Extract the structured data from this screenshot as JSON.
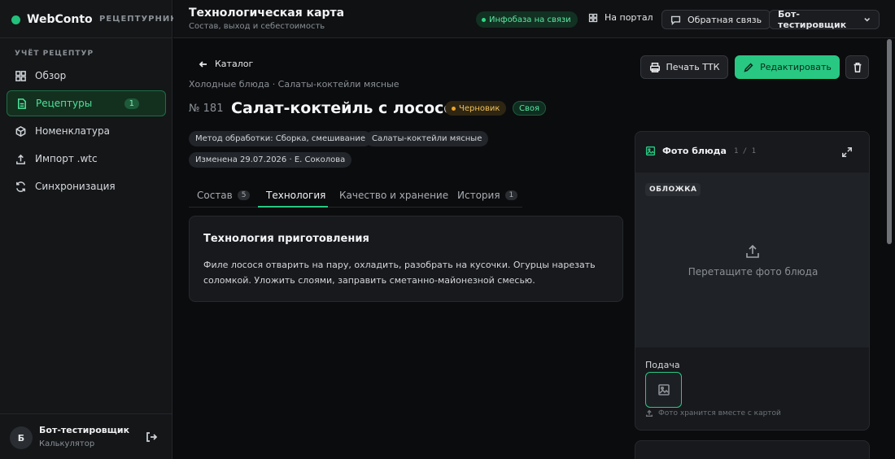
{
  "sidebar": {
    "brand": "WebConto",
    "brand_sub": "РЕЦЕПТУРНИК",
    "section": "УЧЁТ РЕЦЕПТУР",
    "items": [
      {
        "label": "Обзор"
      },
      {
        "label": "Рецептуры",
        "badge": "1"
      },
      {
        "label": "Номенклатура"
      },
      {
        "label": "Импорт .wtc"
      },
      {
        "label": "Синхронизация"
      }
    ],
    "user": {
      "initial": "Б",
      "name": "Бот-тестировщик",
      "role": "Калькулятор"
    }
  },
  "topbar": {
    "title": "Технологическая карта",
    "subtitle": "Состав, выход и себестоимость",
    "status": "Инфобаза на связи",
    "portal": "На портал",
    "feedback": "Обратная связь",
    "user_menu": "Бот-тестировщик"
  },
  "main": {
    "back": "Каталог",
    "breadcrumbs": "Холодные блюда · Салаты-коктейли мясные",
    "number": "№ 181",
    "title": "Салат-коктейль с лососем",
    "status_badge": "Черновик",
    "owner_badge": "Своя",
    "chips": [
      "Метод обработки: Сборка, смешивание",
      "Салаты-коктейли мясные",
      "Изменена 29.07.2026 · Е. Соколова"
    ],
    "actions": {
      "print": "Печать ТТК",
      "edit": "Редактировать"
    },
    "tabs": [
      {
        "label": "Состав",
        "count": "5"
      },
      {
        "label": "Технология"
      },
      {
        "label": "Качество и хранение"
      },
      {
        "label": "История",
        "count": "1"
      }
    ],
    "tech": {
      "title": "Технология приготовления",
      "text": "Филе лосося отварить на пару, охладить, разобрать на кусочки. Огурцы нарезать соломкой. Уложить слоями, заправить сметанно-майонезной смесью."
    }
  },
  "photo": {
    "title": "Фото блюда",
    "count": "1 / 1",
    "cover": "ОБЛОЖКА",
    "drop": "Перетащите фото блюда",
    "serve": "Подача",
    "hint": "Фото хранится вместе с картой"
  },
  "colors": {
    "accent": "#28c882",
    "draft": "#f0c25a",
    "background": "#0b0c0e"
  }
}
